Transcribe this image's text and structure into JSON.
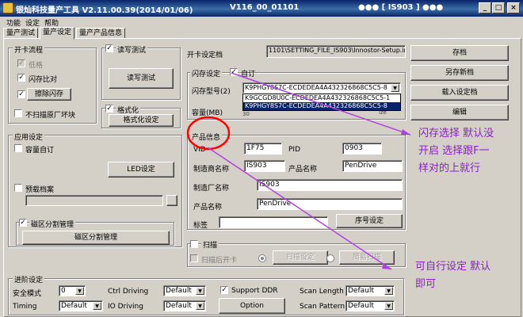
{
  "window": {
    "title": "银灿科技量产工具 V2.11.00.39(2014/01/06)",
    "version": "V116_00_01101",
    "device": "●●● [ IS903 ] ●●●",
    "min_label": "_",
    "max_label": "□",
    "close_label": "×"
  },
  "menu": {
    "items": [
      "功能",
      "设定",
      "帮助"
    ]
  },
  "tabs": [
    "量产测试",
    "量产设定",
    "量产产品信息"
  ],
  "open_card": {
    "title": "开卡流程",
    "low_format": "低格",
    "flash_compare": "闪存比对",
    "erase_flash": "擦除闪存",
    "no_scan_bad": "不扫描原厂坏块",
    "rw_test_check": "读写测试",
    "rw_test_button": "读写测试",
    "format_check": "格式化",
    "format_button": "格式化设定"
  },
  "card_setting_file": {
    "label": "开卡设定档",
    "path": "1101\\SETTING_FILE_IS903\\Innostor-Setup.ini"
  },
  "right_buttons": {
    "save": "存档",
    "save_as": "另存新档",
    "load": "载入设定档",
    "edit": "编辑"
  },
  "flash": {
    "title": "闪存设定",
    "custom": "自订",
    "model_label": "闪存型号(2)",
    "model_value": "K9PHGY8S7C-ECDEDEA4A432326868C5C5-8",
    "options": [
      "K9GCGD8U0C-ECDEDEA4A432326868C5C5-1",
      "K9PHGY8S7C-ECDEDEA4A432326868C5C5-8"
    ],
    "capacity_label": "容量(MB)",
    "capacity_value": "30",
    "capacity_right": "ize"
  },
  "product": {
    "title": "产品信息",
    "vid_label": "VID",
    "vid": "1F75",
    "pid_label": "PID",
    "pid": "0903",
    "maker_label": "制造商名称",
    "maker": "IS903",
    "product_label": "产品名称",
    "product": "PenDrive",
    "factory_label": "制造厂名称",
    "factory": "IS903",
    "product2_label": "产品名称",
    "product2": "PenDrive",
    "tag_label": "标签",
    "serial_button": "序号设定"
  },
  "app": {
    "title": "应用设定",
    "capacity_custom": "容量自订",
    "led_button": "LED设定",
    "preload": "预载档案",
    "partition_check": "磁区分割管理",
    "partition_button": "磁区分割管理"
  },
  "scan": {
    "title": "扫描",
    "scan_after_open": "扫描后开卡",
    "scan_setting": "扫描设定",
    "simple_scan": "简易扫描"
  },
  "advanced": {
    "title": "进阶设定",
    "safe_mode_label": "安全模式",
    "safe_mode": "0",
    "ctrl_driving_label": "Ctrl Driving",
    "ctrl_driving": "Default",
    "support_ddr": "Support DDR",
    "scan_length_label": "Scan Length",
    "scan_length": "Default",
    "timing_label": "Timing",
    "timing": "Default",
    "io_driving_label": "IO Driving",
    "io_driving": "Default",
    "option_button": "Option",
    "scan_pattern_label": "Scan Pattern",
    "scan_pattern": "Default"
  },
  "annotations": {
    "note1_line1": "闪存选择 默认没",
    "note1_line2": "开启  选择跟F一",
    "note1_line3": "样对的上就行",
    "note2_line1": "可自行设定 默认",
    "note2_line2": "即可"
  },
  "colors": {
    "annotation": "#8a1fc8",
    "selection": "#0a246a",
    "circle": "#ff0000"
  }
}
